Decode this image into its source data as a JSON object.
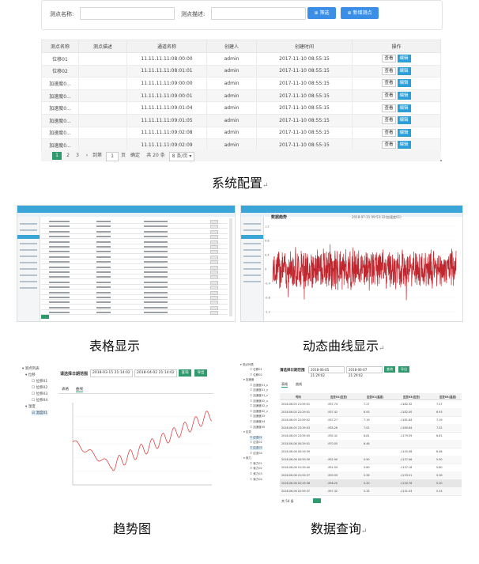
{
  "config": {
    "filter": {
      "name_label": "测点名称:",
      "desc_label": "测点描述:",
      "search_label": "筛选",
      "add_label": "新增测点"
    },
    "headers": [
      "测点名称",
      "测点描述",
      "通道名称",
      "创建人",
      "创建时间",
      "操作"
    ],
    "rows": [
      {
        "name": "位移01",
        "desc": "",
        "channel": "11.11.11.11:08:00:00",
        "creator": "admin",
        "time": "2017-11-10 08:55:15"
      },
      {
        "name": "位移02",
        "desc": "",
        "channel": "11.11.11.11:08:01:01",
        "creator": "admin",
        "time": "2017-11-10 08:55:15"
      },
      {
        "name": "加速度0...",
        "desc": "",
        "channel": "11.11.11.11:09:00:00",
        "creator": "admin",
        "time": "2017-11-10 08:55:15"
      },
      {
        "name": "加速度0...",
        "desc": "",
        "channel": "11.11.11.11:09:00:01",
        "creator": "admin",
        "time": "2017-11-10 08:55:15"
      },
      {
        "name": "加速度0...",
        "desc": "",
        "channel": "11.11.11.11:09:01:04",
        "creator": "admin",
        "time": "2017-11-10 08:55:15"
      },
      {
        "name": "加速度0...",
        "desc": "",
        "channel": "11.11.11.11:09:01:05",
        "creator": "admin",
        "time": "2017-11-10 08:55:15"
      },
      {
        "name": "加速度0...",
        "desc": "",
        "channel": "11.11.11.11:09:02:08",
        "creator": "admin",
        "time": "2017-11-10 08:55:15"
      },
      {
        "name": "加速度0...",
        "desc": "",
        "channel": "11.11.11.11:09:02:09",
        "creator": "admin",
        "time": "2017-11-10 08:55:15"
      }
    ],
    "op_view": "查看",
    "op_edit": "编辑",
    "pager": {
      "pages": [
        "1",
        "2",
        "3"
      ],
      "goto": "到第",
      "page_input": "1",
      "page_unit": "页",
      "confirm": "确定",
      "total": "共 20 条",
      "per_page": "8 条/页"
    }
  },
  "captions": {
    "config": "系统配置",
    "table": "表格显示",
    "dynamic": "动态曲线显示",
    "trend": "趋势图",
    "query": "数据查询",
    "mark": "↵"
  },
  "dynamic": {
    "title": "数据趋势",
    "legend": "2018-07-31 09:53:32(加速度01)",
    "y_ticks": [
      "1.2",
      "0.8",
      "0.4",
      "0",
      "-0.4",
      "-0.8",
      "-1.2"
    ]
  },
  "trend": {
    "time_label": "请选择日期范围",
    "start": "2018-03-15 21:14:02",
    "end": "2018-04-02 21:14:02",
    "query_btn": "查询",
    "export_btn": "导出",
    "tabs": [
      "表格",
      "曲线"
    ],
    "tree_root": "测点列表",
    "tree_group": "位移",
    "tree_items": [
      "位移01",
      "位移02",
      "位移03",
      "位移04"
    ],
    "tree_group2": "温度",
    "tree_items2": [
      "温度01"
    ]
  },
  "query": {
    "time_label": "请选择日期范围",
    "start": "2018-06-05 21:29:02",
    "end": "2018-06-07 21:29:02",
    "query_btn": "查询",
    "export_btn": "导出",
    "tabs": [
      "表格",
      "曲线"
    ],
    "headers": [
      "时间",
      "应变01(应变)",
      "应变01(温度)",
      "应变03(应变)",
      "应变03(温度)"
    ],
    "rows": [
      [
        "2018-06-05 21:59:01",
        "-937.74",
        "7.27",
        "-1182.32",
        "7.27"
      ],
      [
        "2018-06-05 22:29:01",
        "-937.42",
        "6.93",
        "-1182.00",
        "6.93"
      ],
      [
        "2018-06-05 22:59:02",
        "-937.27",
        "7.19",
        "-1181.84",
        "7.19"
      ],
      [
        "2018-06-05 23:29:03",
        "-935.26",
        "7.02",
        "-1180.84",
        "7.02"
      ],
      [
        "2018-06-05 23:59:05",
        "-935.32",
        "6.81",
        "-1179.59",
        "6.81"
      ],
      [
        "2018-06-06 00:29:01",
        "-970.05",
        "6.46",
        "",
        ""
      ],
      [
        "2018-06-06 00:29:39",
        "",
        "",
        "-1145.06",
        "6.46"
      ],
      [
        "2018-06-06 00:59:39",
        "-952.90",
        "5.90",
        "-1137.46",
        "5.90"
      ],
      [
        "2018-06-06 01:29:40",
        "-952.59",
        "5.60",
        "-1137.16",
        "5.60"
      ],
      [
        "2018-06-06 01:59:37",
        "-959.99",
        "5.28",
        "-1133.51",
        "5.28"
      ],
      [
        "2018-06-06 02:29:38",
        "-958.25",
        "5.20",
        "-1130.76",
        "5.20"
      ],
      [
        "2018-06-06 02:59:37",
        "-957.32",
        "5.33",
        "-1131.53",
        "5.33"
      ]
    ],
    "total": "共 54 条",
    "tree_root": "测点列表",
    "tree_items": [
      "位移01",
      "位移02",
      "加速度",
      "加速度01_x",
      "加速度01_y",
      "加速度01_z",
      "加速度02_x",
      "加速度02_y",
      "加速度02_z",
      "加速度03",
      "加速度04",
      "加速度05",
      "应变",
      "应变01",
      "应变02",
      "应变03",
      "应变04",
      "索力",
      "索力01",
      "索力02",
      "索力03",
      "索力04"
    ]
  }
}
